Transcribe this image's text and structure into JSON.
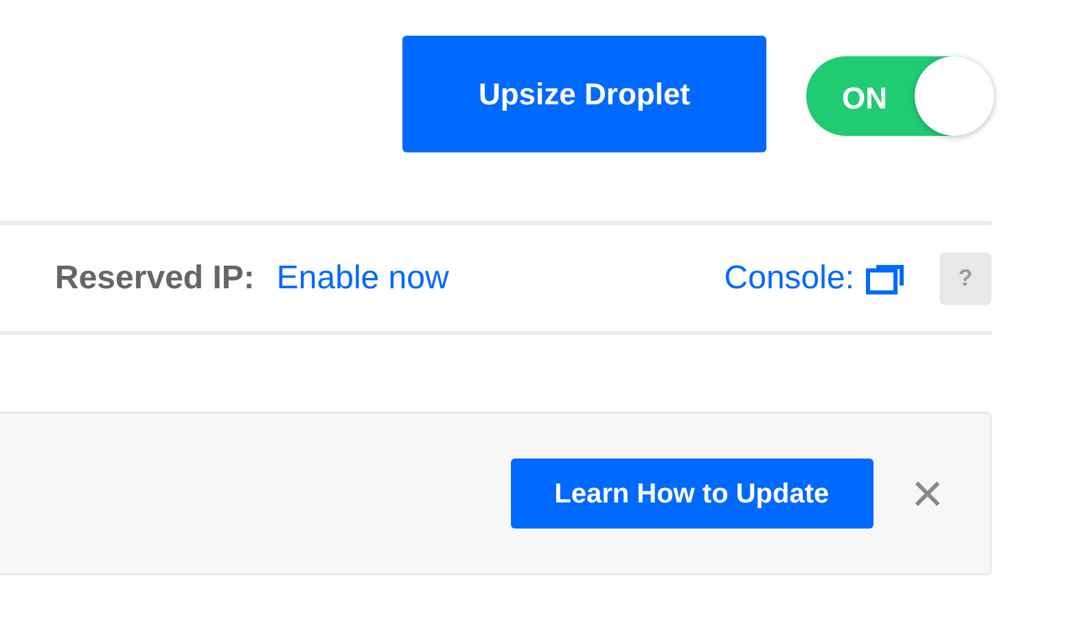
{
  "header": {
    "upsize_button": "Upsize Droplet",
    "power_toggle": {
      "label": "ON",
      "on": true
    }
  },
  "info_bar": {
    "reserved_ip_label": "Reserved IP:",
    "reserved_ip_link": "Enable now",
    "console_link": "Console:",
    "help_button": "?"
  },
  "notice": {
    "button": "Learn How to Update",
    "close": "×"
  }
}
